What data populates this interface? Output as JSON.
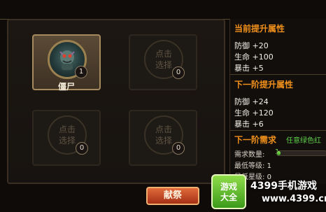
{
  "slots": [
    {
      "name": "僵尸",
      "count": "1",
      "selected": true
    },
    {
      "pick_label": "点击\n选择",
      "count": "0"
    },
    {
      "pick_label": "点击\n选择",
      "count": "0"
    },
    {
      "pick_label": "点击\n选择",
      "count": "0"
    }
  ],
  "current": {
    "title": "当前提升属性",
    "attrs": [
      "防御 +20",
      "生命 +100",
      "暴击 +5"
    ]
  },
  "next": {
    "title": "下一阶提升属性",
    "attrs": [
      "防御 +24",
      "生命 +120",
      "暴击 +6"
    ]
  },
  "requirements": {
    "title": "下一阶需求",
    "hint": "任意绿色红",
    "qty_label": "需求数量:",
    "qty_progress_value": "1",
    "qty_progress_fraction": 0.07,
    "min_level_label": "最低等级:",
    "min_level_value": "1",
    "min_star_label": "最低星级:",
    "min_star_value": "0"
  },
  "donate_label": "献祭",
  "watermark": {
    "logo": "游戏\n大全",
    "site": "4399手机游戏",
    "domain": "www.4399.cn"
  },
  "colors": {
    "accent": "#f0901c",
    "positive": "#5fd04a"
  }
}
